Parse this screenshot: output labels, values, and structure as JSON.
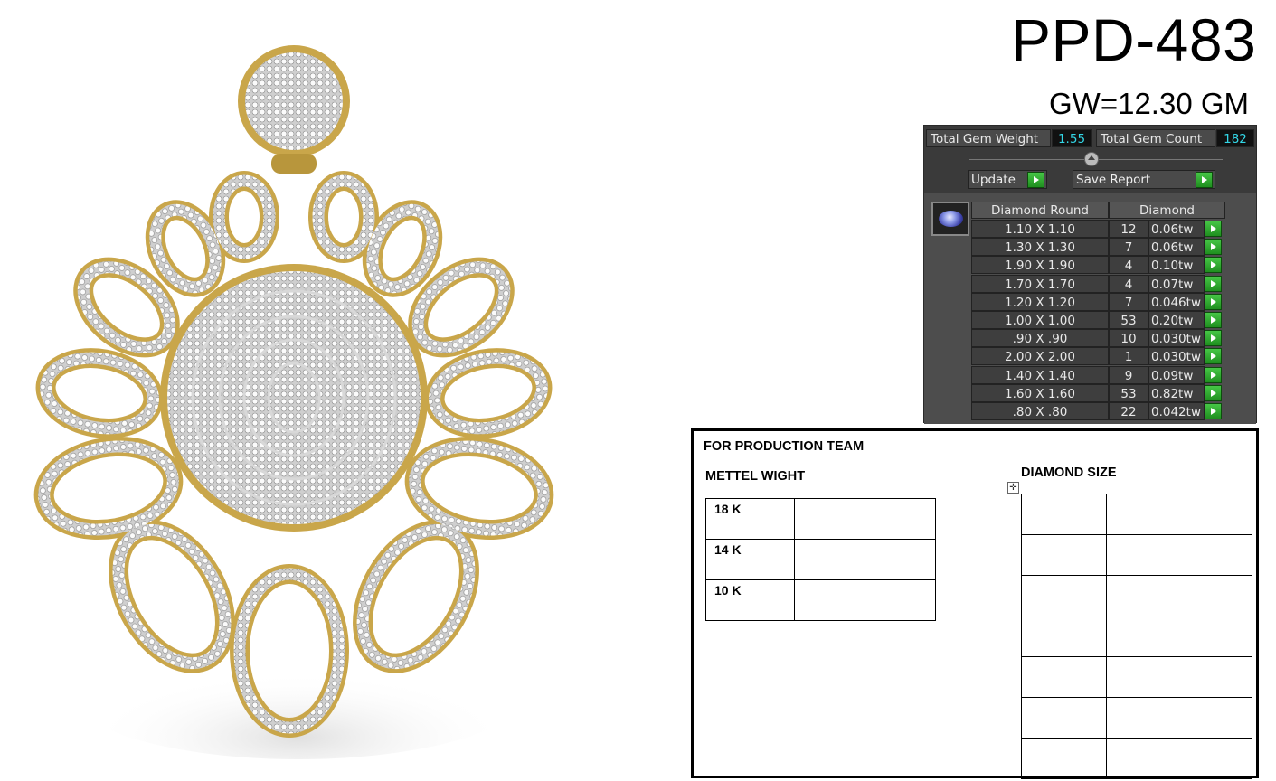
{
  "header": {
    "design_code": "PPD-483",
    "gross_weight": "GW=12.30 GM"
  },
  "product_image": {
    "subject": "pendant-render",
    "metal_color": "#c9a64a",
    "stone_color": "#f2f2f2"
  },
  "gem_panel": {
    "total_gem_weight_label": "Total Gem Weight",
    "total_gem_weight": "1.55",
    "total_gem_count_label": "Total Gem Count",
    "total_gem_count": "182",
    "update_label": "Update",
    "save_report_label": "Save Report",
    "col_shape": "Diamond Round",
    "col_material": "Diamond",
    "rows": [
      {
        "size": "1.10 X 1.10",
        "count": "12",
        "weight": "0.06tw"
      },
      {
        "size": "1.30 X 1.30",
        "count": "7",
        "weight": "0.06tw"
      },
      {
        "size": "1.90 X 1.90",
        "count": "4",
        "weight": "0.10tw"
      },
      {
        "size": "1.70 X 1.70",
        "count": "4",
        "weight": "0.07tw"
      },
      {
        "size": "1.20 X 1.20",
        "count": "7",
        "weight": "0.046tw"
      },
      {
        "size": "1.00 X 1.00",
        "count": "53",
        "weight": "0.20tw"
      },
      {
        "size": ".90 X .90",
        "count": "10",
        "weight": "0.030tw"
      },
      {
        "size": "2.00 X 2.00",
        "count": "1",
        "weight": "0.030tw"
      },
      {
        "size": "1.40 X 1.40",
        "count": "9",
        "weight": "0.09tw"
      },
      {
        "size": "1.60 X 1.60",
        "count": "53",
        "weight": "0.82tw"
      },
      {
        "size": ".80 X .80",
        "count": "22",
        "weight": "0.042tw"
      }
    ]
  },
  "production": {
    "title": "FOR PRODUCTION TEAM",
    "metal_title": "METTEL WIGHT",
    "diamond_title": "DIAMOND SIZE",
    "metal_rows": [
      "18 K",
      "14 K",
      "10 K"
    ]
  }
}
